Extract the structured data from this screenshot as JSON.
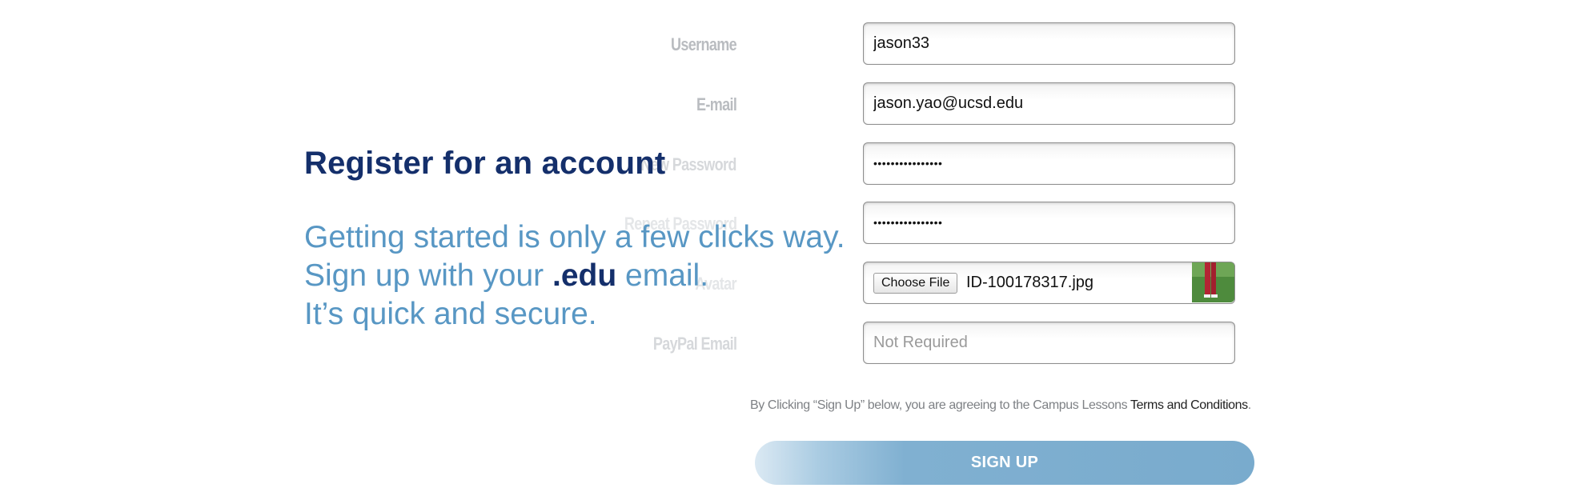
{
  "promo": {
    "title": "Register for an account",
    "line1": "Getting started is only a few clicks way.",
    "line2_pre": "Sign up with your ",
    "line2_strong": ".edu",
    "line2_post": " email.",
    "line3": "It’s quick and secure."
  },
  "form": {
    "username": {
      "label": "Username",
      "value": "jason33"
    },
    "email": {
      "label": "E-mail",
      "value": "jason.yao@ucsd.edu"
    },
    "new_password": {
      "label": "New Password",
      "value": "••••••••••••••••"
    },
    "repeat_password": {
      "label": "Repeat Password",
      "value": "••••••••••••••••"
    },
    "avatar": {
      "label": "Avatar",
      "button_label": "Choose File",
      "file_name": "ID-100178317.jpg"
    },
    "paypal_email": {
      "label": "PayPal Email",
      "value": "",
      "placeholder": "Not Required"
    }
  },
  "terms": {
    "text": "By Clicking “Sign Up” below, you are agreeing to the Campus Lessons ",
    "link": "Terms and Conditions",
    "suffix": "."
  },
  "signup_button": {
    "label": "SIGN UP"
  },
  "colors": {
    "title": "#142f6b",
    "promo_text": "#5897c4",
    "label": "#b9bcc0",
    "button": "#79abcd"
  }
}
